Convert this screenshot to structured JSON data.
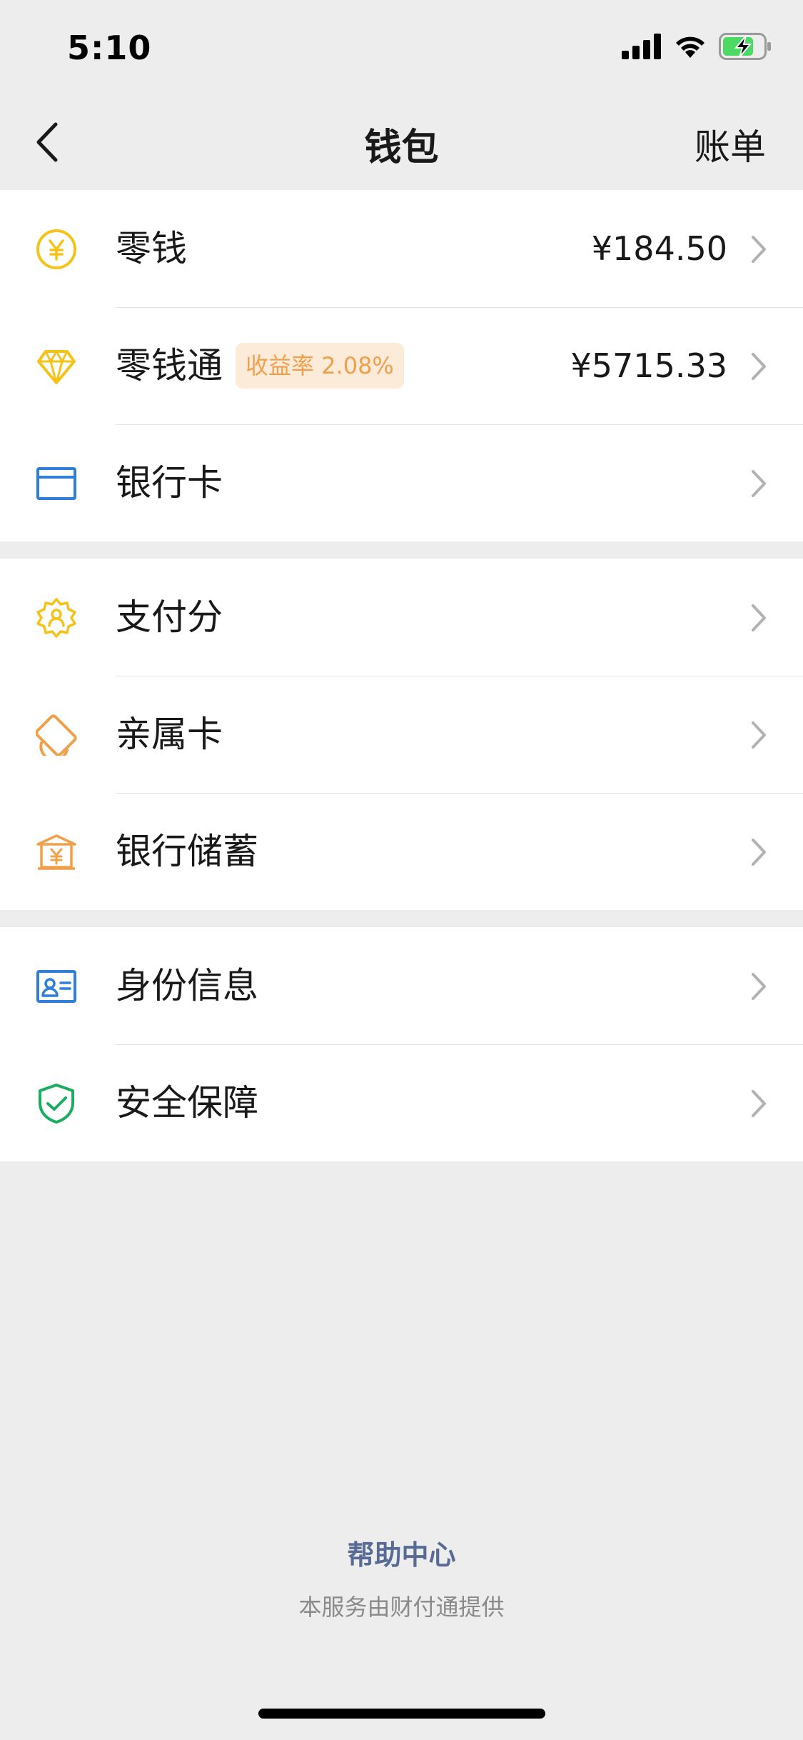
{
  "status_bar": {
    "time": "5:10"
  },
  "nav": {
    "title": "钱包",
    "right_action": "账单"
  },
  "group1": [
    {
      "label": "零钱",
      "value": "¥184.50",
      "icon": "yuan-coin-icon"
    },
    {
      "label": "零钱通",
      "badge": "收益率 2.08%",
      "value": "¥5715.33",
      "icon": "diamond-icon"
    },
    {
      "label": "银行卡",
      "icon": "bank-card-icon"
    }
  ],
  "group2": [
    {
      "label": "支付分",
      "icon": "pay-score-icon"
    },
    {
      "label": "亲属卡",
      "icon": "family-card-icon"
    },
    {
      "label": "银行储蓄",
      "icon": "bank-deposit-icon"
    }
  ],
  "group3": [
    {
      "label": "身份信息",
      "icon": "id-card-icon"
    },
    {
      "label": "安全保障",
      "icon": "shield-check-icon"
    }
  ],
  "footer": {
    "help_center": "帮助中心",
    "provider": "本服务由财付通提供"
  },
  "colors": {
    "background": "#EDEDED",
    "yellow": "#F5C318",
    "orange": "#F0A04B",
    "blue": "#2F7FD9",
    "green": "#1AAD61",
    "link": "#576B95",
    "battery_green": "#4CD964"
  }
}
